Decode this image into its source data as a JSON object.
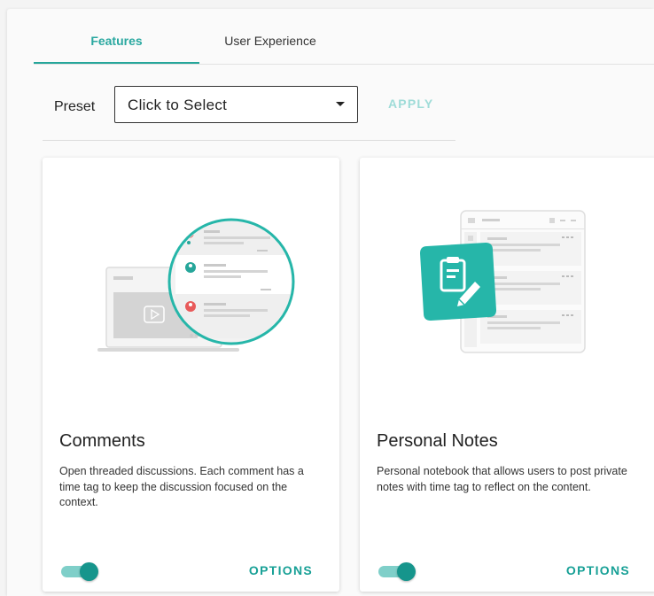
{
  "tabs": [
    {
      "label": "Features",
      "active": true
    },
    {
      "label": "User Experience",
      "active": false
    }
  ],
  "preset": {
    "label": "Preset",
    "select_value": "Click to Select",
    "apply_label": "APPLY"
  },
  "cards": [
    {
      "title": "Comments",
      "description": "Open threaded discussions. Each comment has a time tag to keep the discussion focused on the context.",
      "enabled": true,
      "options_label": "OPTIONS",
      "illustration_icon": "comments-illustration-icon"
    },
    {
      "title": "Personal Notes",
      "description": "Personal notebook that allows users to post private notes with time tag to reflect on the content.",
      "enabled": true,
      "options_label": "OPTIONS",
      "illustration_icon": "personal-notes-illustration-icon"
    }
  ],
  "colors": {
    "accent": "#26a69a",
    "accent_light": "#9fdcd8",
    "toggle_track": "#7fcfc9",
    "toggle_thumb": "#16958c",
    "avatar_red": "#e85a5a"
  }
}
